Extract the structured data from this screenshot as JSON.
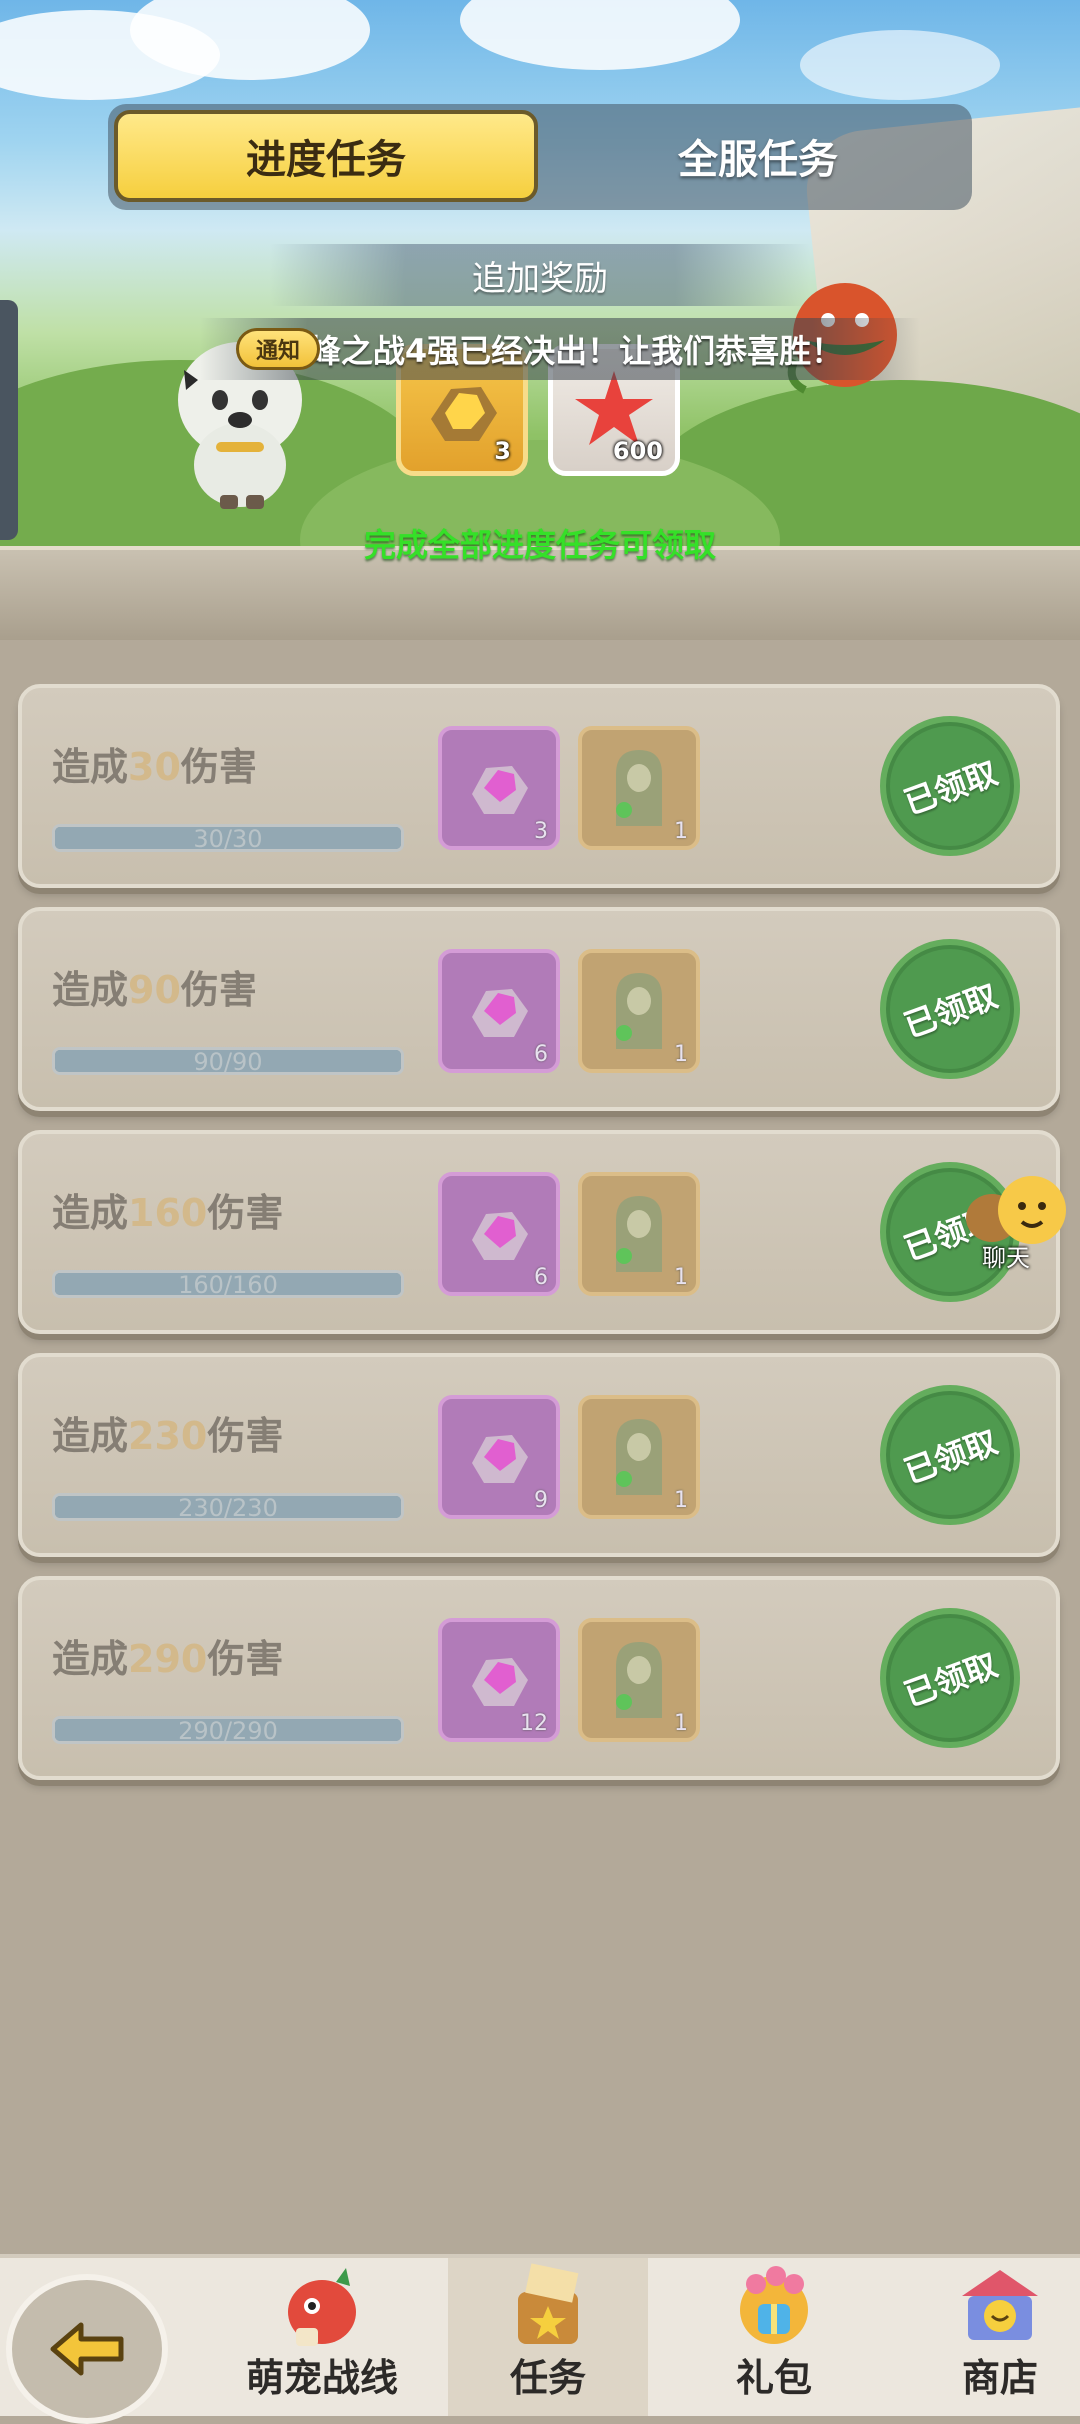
{
  "tabs": {
    "progress": "进度任务",
    "server": "全服任务"
  },
  "bonus": {
    "title": "追加奖励",
    "notice_badge": "通知",
    "notice_text": "巅峰之战4强已经决出！让我们恭喜胜！",
    "items": [
      {
        "icon": "gold-ore-icon",
        "count": "3"
      },
      {
        "icon": "starfish-icon",
        "count": "600"
      }
    ],
    "claim_hint": "完成全部进度任务可领取"
  },
  "tasks": [
    {
      "prefix": "造成",
      "number": "30",
      "suffix": "伤害",
      "progress_text": "30/30",
      "progress": 1.0,
      "gem_count": "3",
      "statue_count": "1",
      "status": "已领取"
    },
    {
      "prefix": "造成",
      "number": "90",
      "suffix": "伤害",
      "progress_text": "90/90",
      "progress": 1.0,
      "gem_count": "6",
      "statue_count": "1",
      "status": "已领取"
    },
    {
      "prefix": "造成",
      "number": "160",
      "suffix": "伤害",
      "progress_text": "160/160",
      "progress": 1.0,
      "gem_count": "6",
      "statue_count": "1",
      "status": "已领取"
    },
    {
      "prefix": "造成",
      "number": "230",
      "suffix": "伤害",
      "progress_text": "230/230",
      "progress": 1.0,
      "gem_count": "9",
      "statue_count": "1",
      "status": "已领取"
    },
    {
      "prefix": "造成",
      "number": "290",
      "suffix": "伤害",
      "progress_text": "290/290",
      "progress": 1.0,
      "gem_count": "12",
      "statue_count": "1",
      "status": "已领取"
    }
  ],
  "chat": {
    "label": "聊天"
  },
  "nav": {
    "back_icon": "back-arrow-icon",
    "items": [
      {
        "label": "萌宠战线",
        "icon": "dragon-pet-icon"
      },
      {
        "label": "任务",
        "icon": "task-scroll-icon"
      },
      {
        "label": "礼包",
        "icon": "gift-bag-icon"
      },
      {
        "label": "商店",
        "icon": "shop-stall-icon"
      }
    ]
  },
  "colors": {
    "tab_active": "#f6cf3e",
    "claimed_stamp": "#4f9a4f",
    "claim_hint": "#35e028",
    "task_number": "#d3b98b"
  }
}
